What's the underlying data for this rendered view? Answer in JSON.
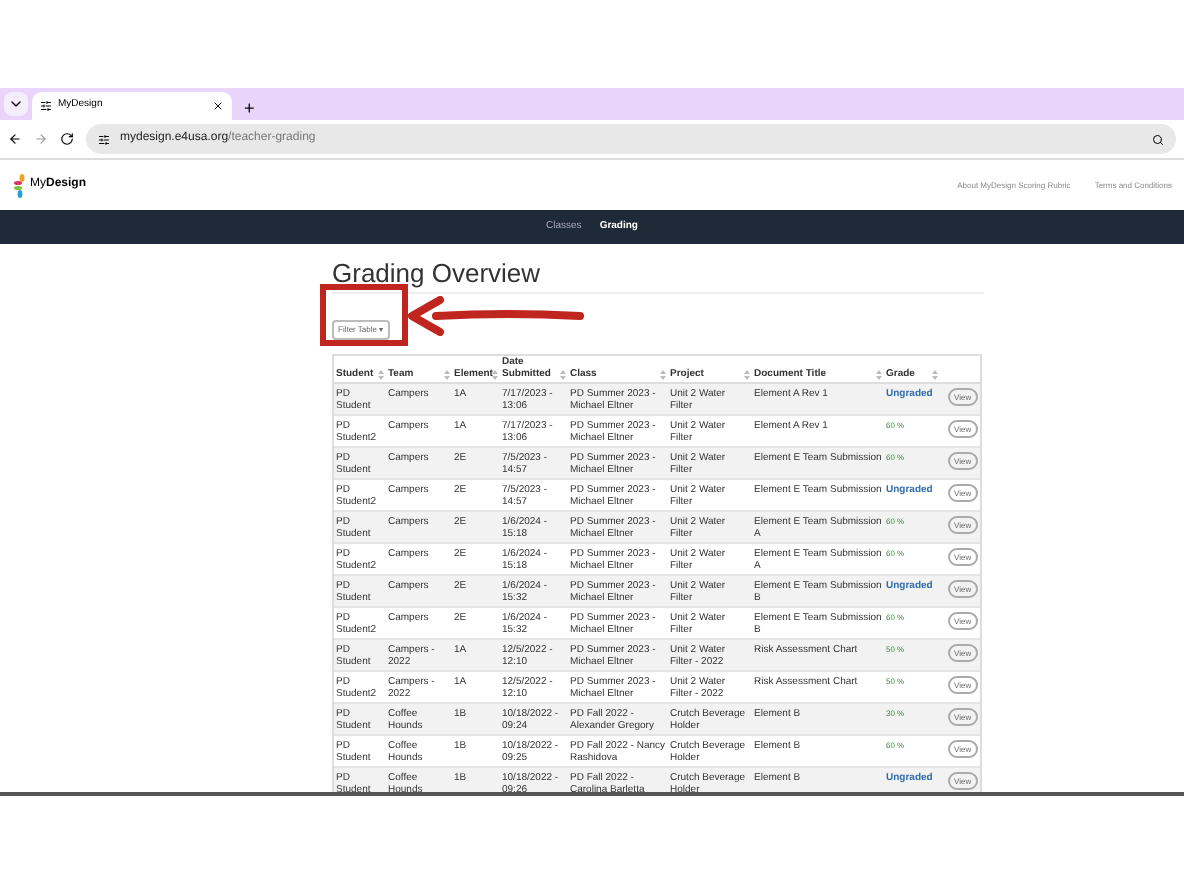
{
  "browser": {
    "tab_title": "MyDesign",
    "new_tab": "+",
    "url_host": "mydesign.e4usa.org",
    "url_path": "/teacher-grading"
  },
  "header": {
    "logo_my": "My",
    "logo_design": "Design",
    "links": [
      "About MyDesign Scoring Rubric",
      "Terms and Conditions"
    ]
  },
  "nav": [
    {
      "label": "Classes",
      "selected": false
    },
    {
      "label": "Grading",
      "selected": true
    }
  ],
  "page_title": "Grading Overview",
  "filter_button": "Filter Table",
  "filter_caret": "▾",
  "table": {
    "columns": [
      "Student",
      "Team",
      "Element",
      "Date Submitted",
      "Class",
      "Project",
      "Document Title",
      "Grade"
    ],
    "rows": [
      {
        "cells": [
          "PD Student",
          "Campers",
          "1A",
          "7/17/2023 - 13:06",
          "PD Summer 2023 - Michael Eltner",
          "Unit 2 Water Filter",
          "Element A Rev 1"
        ],
        "grade": "Ungraded",
        "graded": false,
        "action": "View"
      },
      {
        "cells": [
          "PD Student2",
          "Campers",
          "1A",
          "7/17/2023 - 13:06",
          "PD Summer 2023 - Michael Eltner",
          "Unit 2 Water Filter",
          "Element A Rev 1"
        ],
        "grade": "60 %",
        "graded": true,
        "action": "View"
      },
      {
        "cells": [
          "PD Student",
          "Campers",
          "2E",
          "7/5/2023 - 14:57",
          "PD Summer 2023 - Michael Eltner",
          "Unit 2 Water Filter",
          "Element E Team Submission"
        ],
        "grade": "60 %",
        "graded": true,
        "action": "View"
      },
      {
        "cells": [
          "PD Student2",
          "Campers",
          "2E",
          "7/5/2023 - 14:57",
          "PD Summer 2023 - Michael Eltner",
          "Unit 2 Water Filter",
          "Element E Team Submission"
        ],
        "grade": "Ungraded",
        "graded": false,
        "action": "View"
      },
      {
        "cells": [
          "PD Student",
          "Campers",
          "2E",
          "1/6/2024 - 15:18",
          "PD Summer 2023 - Michael Eltner",
          "Unit 2 Water Filter",
          "Element E Team Submission A"
        ],
        "grade": "60 %",
        "graded": true,
        "action": "View"
      },
      {
        "cells": [
          "PD Student2",
          "Campers",
          "2E",
          "1/6/2024 - 15:18",
          "PD Summer 2023 - Michael Eltner",
          "Unit 2 Water Filter",
          "Element E Team Submission A"
        ],
        "grade": "60 %",
        "graded": true,
        "action": "View"
      },
      {
        "cells": [
          "PD Student",
          "Campers",
          "2E",
          "1/6/2024 - 15:32",
          "PD Summer 2023 - Michael Eltner",
          "Unit 2 Water Filter",
          "Element E Team Submission B"
        ],
        "grade": "Ungraded",
        "graded": false,
        "action": "View"
      },
      {
        "cells": [
          "PD Student2",
          "Campers",
          "2E",
          "1/6/2024 - 15:32",
          "PD Summer 2023 - Michael Eltner",
          "Unit 2 Water Filter",
          "Element E Team Submission B"
        ],
        "grade": "60 %",
        "graded": true,
        "action": "View"
      },
      {
        "cells": [
          "PD Student",
          "Campers - 2022",
          "1A",
          "12/5/2022 - 12:10",
          "PD Summer 2023 - Michael Eltner",
          "Unit 2 Water Filter - 2022",
          "Risk Assessment Chart"
        ],
        "grade": "50 %",
        "graded": true,
        "action": "View"
      },
      {
        "cells": [
          "PD Student2",
          "Campers - 2022",
          "1A",
          "12/5/2022 - 12:10",
          "PD Summer 2023 - Michael Eltner",
          "Unit 2 Water Filter - 2022",
          "Risk Assessment Chart"
        ],
        "grade": "50 %",
        "graded": true,
        "action": "View"
      },
      {
        "cells": [
          "PD Student",
          "Coffee Hounds",
          "1B",
          "10/18/2022 - 09:24",
          "PD Fall 2022 - Alexander Gregory",
          "Crutch Beverage Holder",
          "Element B"
        ],
        "grade": "30 %",
        "graded": true,
        "action": "View"
      },
      {
        "cells": [
          "PD Student",
          "Coffee Hounds",
          "1B",
          "10/18/2022 - 09:25",
          "PD Fall 2022 - Nancy Rashidova",
          "Crutch Beverage Holder",
          "Element B"
        ],
        "grade": "60 %",
        "graded": true,
        "action": "View"
      },
      {
        "cells": [
          "PD Student",
          "Coffee Hounds",
          "1B",
          "10/18/2022 - 09:26",
          "PD Fall 2022 - Carolina Barletta",
          "Crutch Beverage Holder",
          "Element B"
        ],
        "grade": "Ungraded",
        "graded": false,
        "action": "View"
      }
    ]
  }
}
